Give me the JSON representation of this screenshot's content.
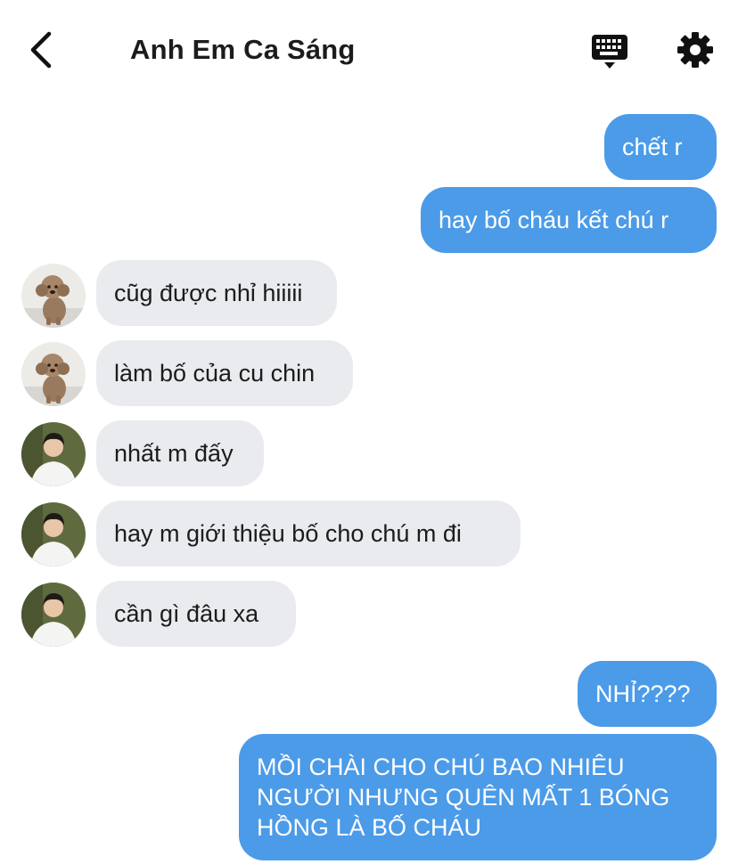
{
  "header": {
    "title": "Anh Em Ca Sáng",
    "back_icon": "chevron-left-icon",
    "keyboard_icon": "keyboard-icon",
    "settings_icon": "gear-icon"
  },
  "colors": {
    "outgoing_bubble": "#4b9be8",
    "incoming_bubble": "#e9ebee"
  },
  "messages": [
    {
      "direction": "outgoing",
      "text": "chết r"
    },
    {
      "direction": "outgoing",
      "text": "hay bố cháu kết chú r"
    },
    {
      "direction": "incoming",
      "avatar": "poodle-avatar",
      "text": "cũg được nhỉ hiiiii"
    },
    {
      "direction": "incoming",
      "avatar": "poodle-avatar",
      "text": "làm bố của cu chin"
    },
    {
      "direction": "incoming",
      "avatar": "young-man-avatar",
      "text": "nhất m đấy"
    },
    {
      "direction": "incoming",
      "avatar": "young-man-avatar",
      "text": "hay m giới thiệu bố cho chú m đi"
    },
    {
      "direction": "incoming",
      "avatar": "young-man-avatar",
      "text": "cần gì đâu xa"
    },
    {
      "direction": "outgoing",
      "text": "NHỈ????"
    },
    {
      "direction": "outgoing",
      "text": "MỒI CHÀI CHO CHÚ BAO NHIÊU NGƯỜI NHƯNG QUÊN MẤT 1 BÓNG HỒNG LÀ BỐ CHÁU"
    }
  ]
}
